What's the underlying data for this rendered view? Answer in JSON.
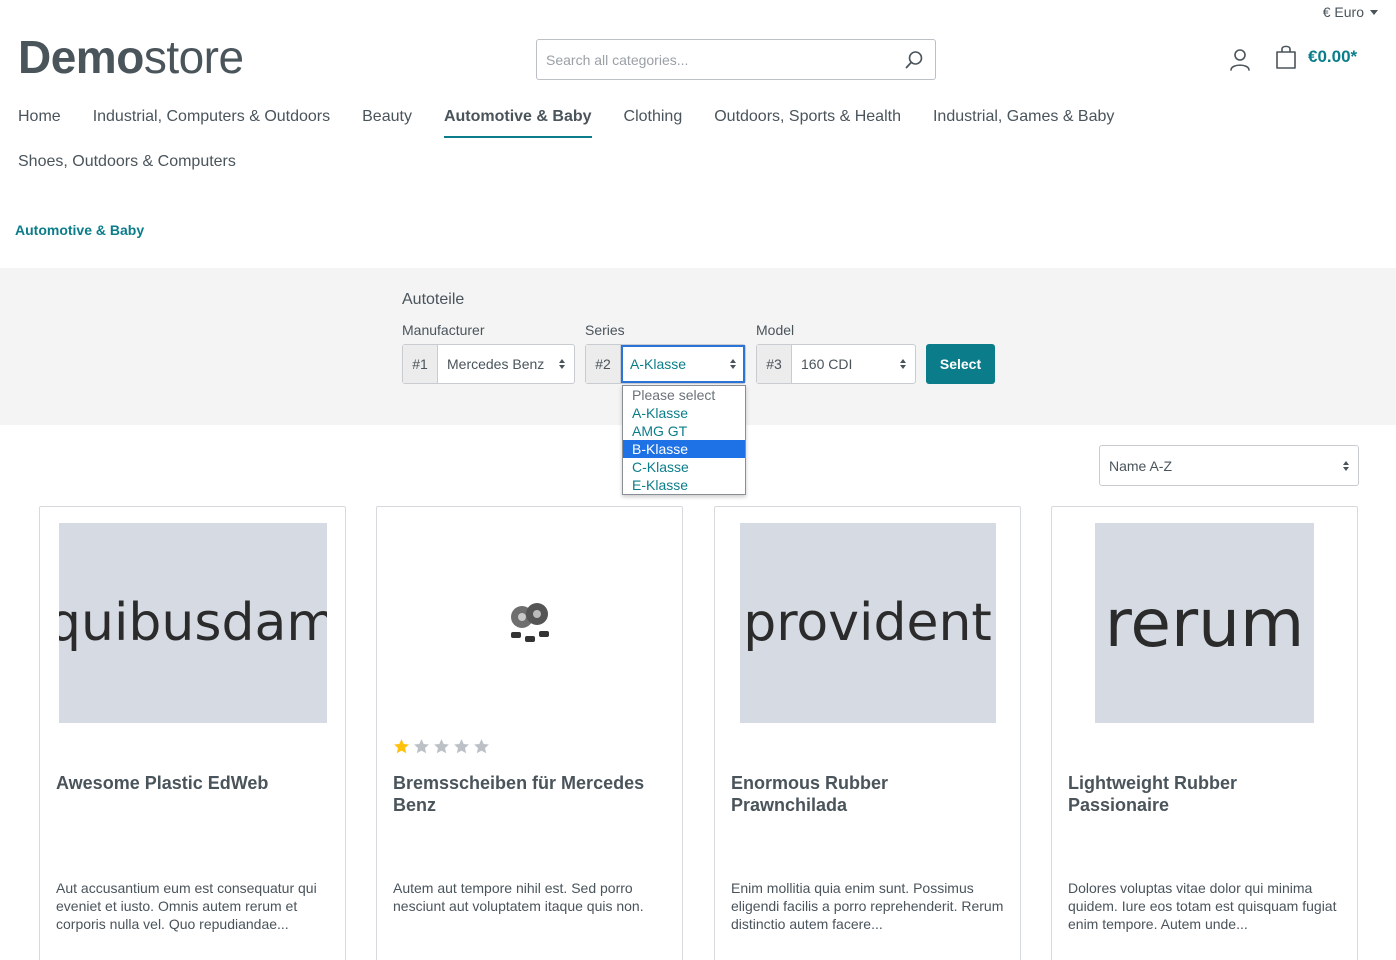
{
  "header": {
    "currency": "€ Euro",
    "logo_bold": "Demo",
    "logo_rest": "store",
    "search_placeholder": "Search all categories...",
    "cart_total": "€0.00*"
  },
  "nav": {
    "row1": [
      "Home",
      "Industrial, Computers & Outdoors",
      "Beauty",
      "Automotive & Baby",
      "Clothing",
      "Outdoors, Sports & Health",
      "Industrial, Games & Baby"
    ],
    "row2": [
      "Shoes, Outdoors & Computers"
    ],
    "active": "Automotive & Baby"
  },
  "breadcrumb": "Automotive & Baby",
  "filter": {
    "title": "Autoteile",
    "manufacturer": {
      "label": "Manufacturer",
      "num": "#1",
      "value": "Mercedes Benz"
    },
    "series": {
      "label": "Series",
      "num": "#2",
      "value": "A-Klasse"
    },
    "model": {
      "label": "Model",
      "num": "#3",
      "value": "160 CDI"
    },
    "select_button": "Select",
    "series_options": [
      "Please select",
      "A-Klasse",
      "AMG GT",
      "B-Klasse",
      "C-Klasse",
      "E-Klasse"
    ],
    "series_highlighted": "B-Klasse"
  },
  "sort": {
    "value": "Name A-Z"
  },
  "colors": {
    "accent": "#0b7d8a",
    "highlight": "#1e72e6",
    "star_filled": "#ffc20e",
    "star_empty": "#bcc1c7"
  },
  "products": [
    {
      "image_text": "quibusdam",
      "title": "Awesome Plastic EdWeb",
      "description": "Aut accusantium eum est consequatur qui eveniet et iusto. Omnis autem rerum et corporis nulla vel. Quo repudiandae...",
      "rating": null
    },
    {
      "image_text": "",
      "title": "Bremsscheiben für Mercedes Benz",
      "description": "Autem aut tempore nihil est. Sed porro nesciunt aut voluptatem itaque quis non.",
      "rating": 1,
      "rating_max": 5
    },
    {
      "image_text": "provident",
      "title": "Enormous Rubber Prawnchilada",
      "description": "Enim mollitia quia enim sunt. Possimus eligendi facilis a porro reprehenderit. Rerum distinctio autem facere...",
      "rating": null
    },
    {
      "image_text": "rerum",
      "title": "Lightweight Rubber Passionaire",
      "description": "Dolores voluptas vitae dolor qui minima quidem. Iure eos totam est quisquam fugiat enim tempore. Autem unde...",
      "rating": null
    }
  ]
}
